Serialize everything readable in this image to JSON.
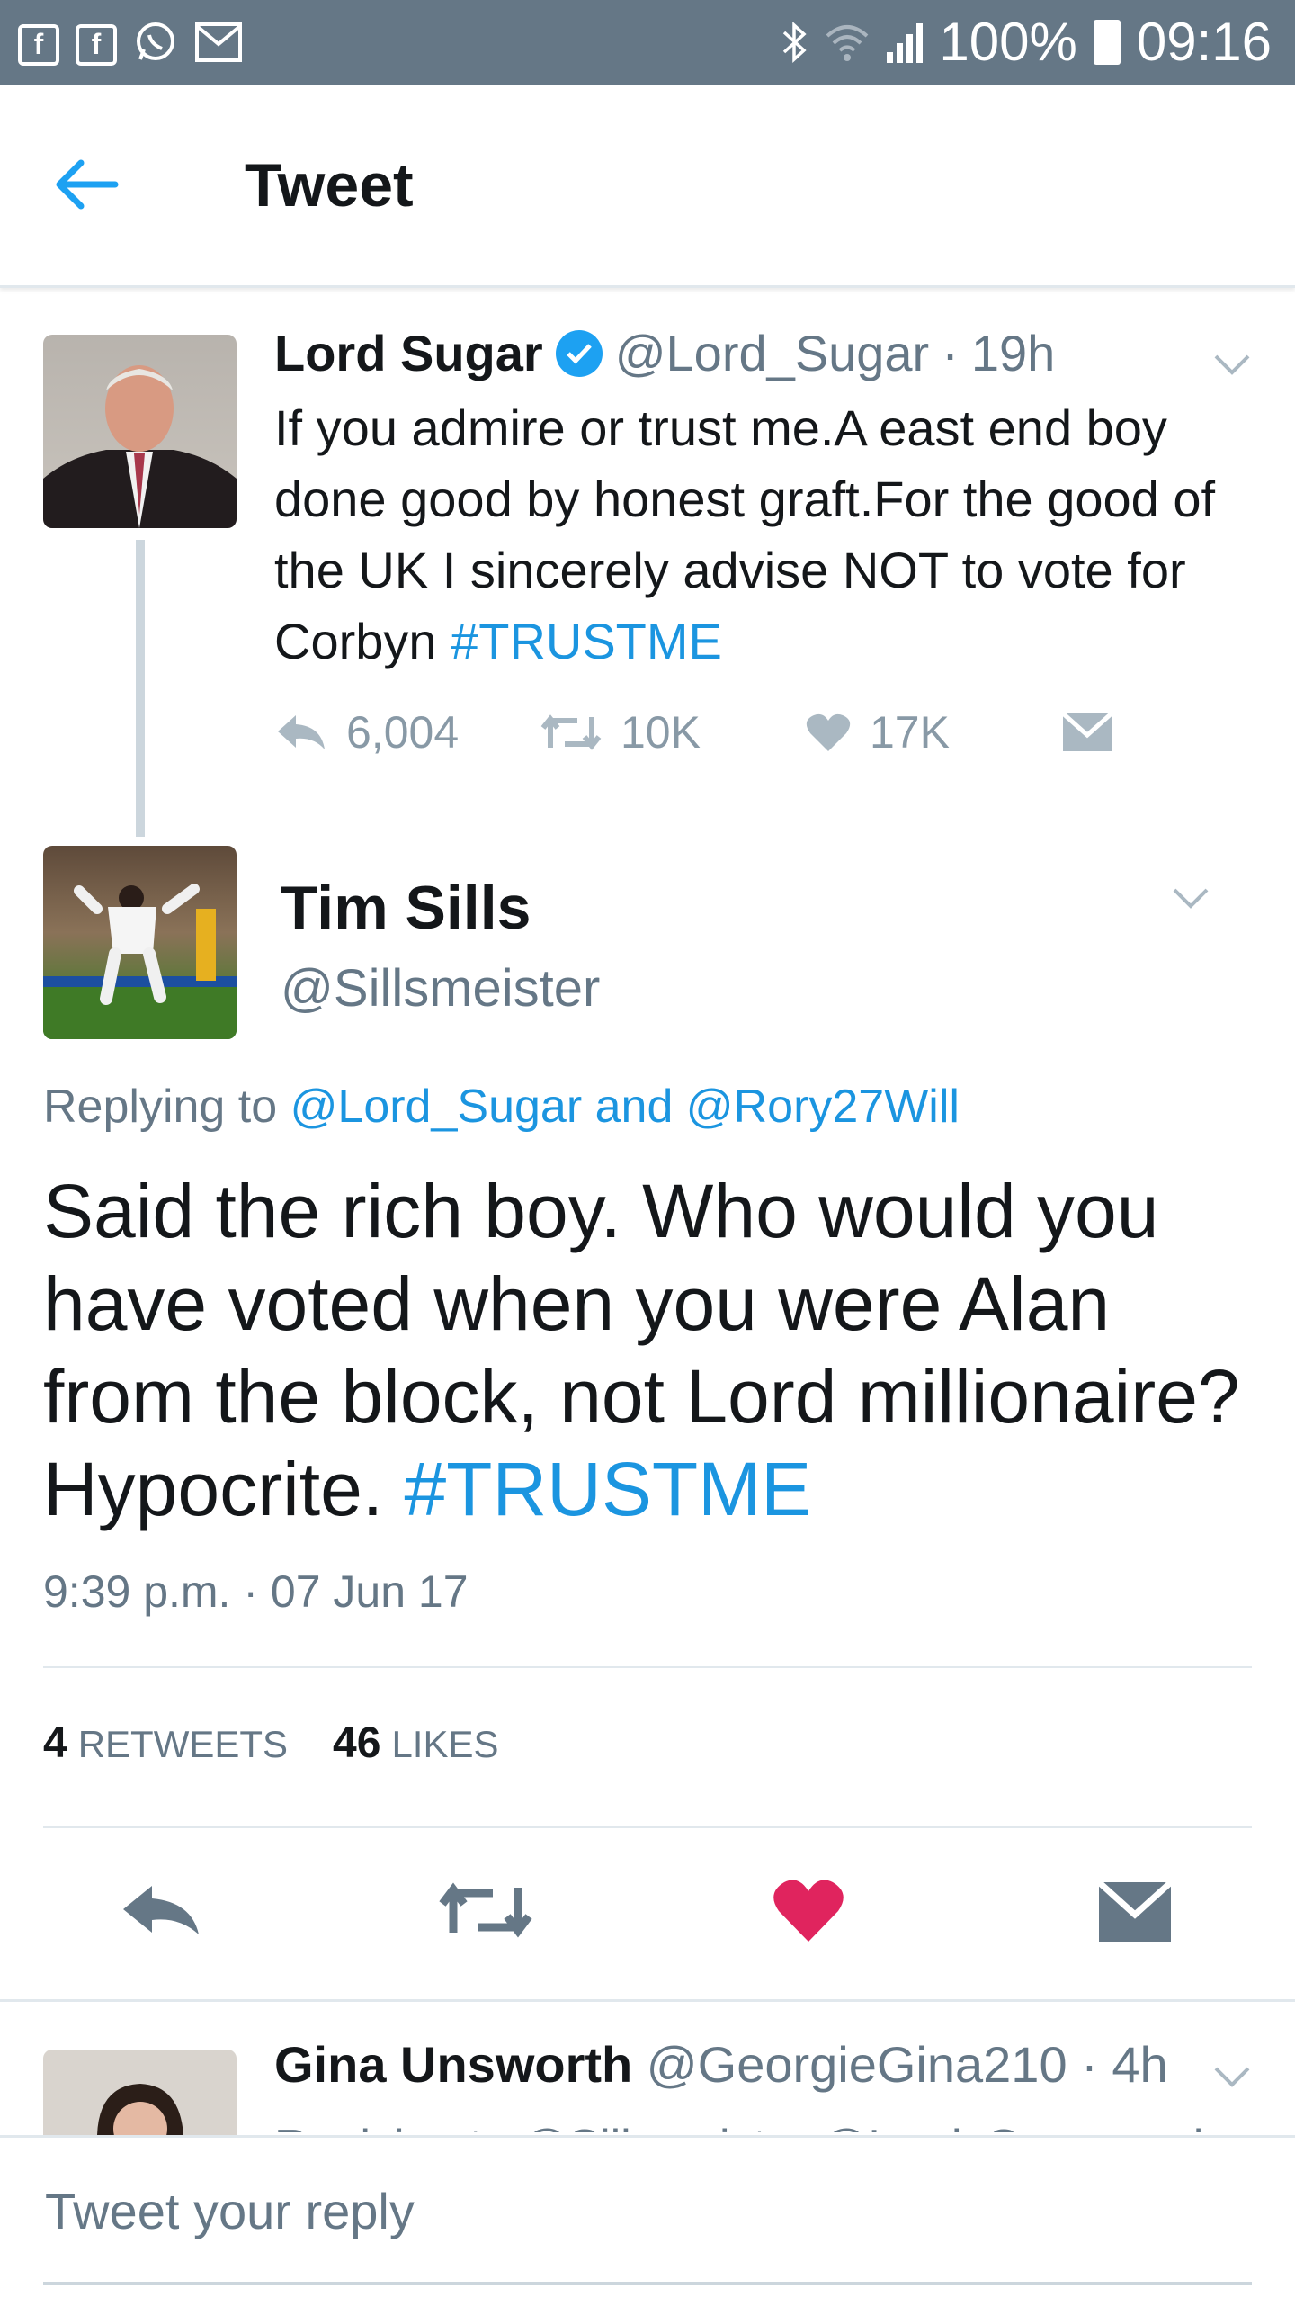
{
  "status_bar": {
    "battery": "100%",
    "time": "09:16",
    "left_icons": [
      "facebook-icon",
      "facebook-icon",
      "whatsapp-icon",
      "gmail-icon"
    ],
    "right_icons": [
      "bluetooth-icon",
      "wifi-icon",
      "signal-icon",
      "battery-icon"
    ]
  },
  "header": {
    "title": "Tweet",
    "back_icon": "back-arrow-icon"
  },
  "colors": {
    "link": "#1b95e0",
    "muted": "#657786",
    "like": "#e0245e",
    "status_bar": "#657786"
  },
  "parent_tweet": {
    "name": "Lord Sugar",
    "verified": true,
    "handle": "@Lord_Sugar",
    "sep": "·",
    "age": "19h",
    "text": "If you admire or trust me.A east end boy done good by honest graft.For the good of the UK I sincerely advise NOT to vote for Corbyn ",
    "hashtag": "#TRUSTME",
    "replies": "6,004",
    "retweets": "10K",
    "likes": "17K"
  },
  "main_tweet": {
    "name": "Tim Sills",
    "handle": "@Sillsmeister",
    "replying_prefix": "Replying to ",
    "replying_to": "@Lord_Sugar and @Rory27Will",
    "text": "Said the rich boy. Who would you have voted when you were Alan from the block, not Lord millionaire? Hypocrite. ",
    "hashtag": "#TRUSTME",
    "timestamp": "9:39 p.m. · 07 Jun 17",
    "retweet_count": "4",
    "retweet_label": "RETWEETS",
    "like_count": "46",
    "like_label": "LIKES",
    "liked": true
  },
  "reply_tweet": {
    "name": "Gina Unsworth",
    "handle": "@GeorgieGina210",
    "sep": "·",
    "age": "4h",
    "replying": "Replying to @Sillsmeister @Lord_Sugar and"
  },
  "composer": {
    "placeholder": "Tweet your reply"
  }
}
